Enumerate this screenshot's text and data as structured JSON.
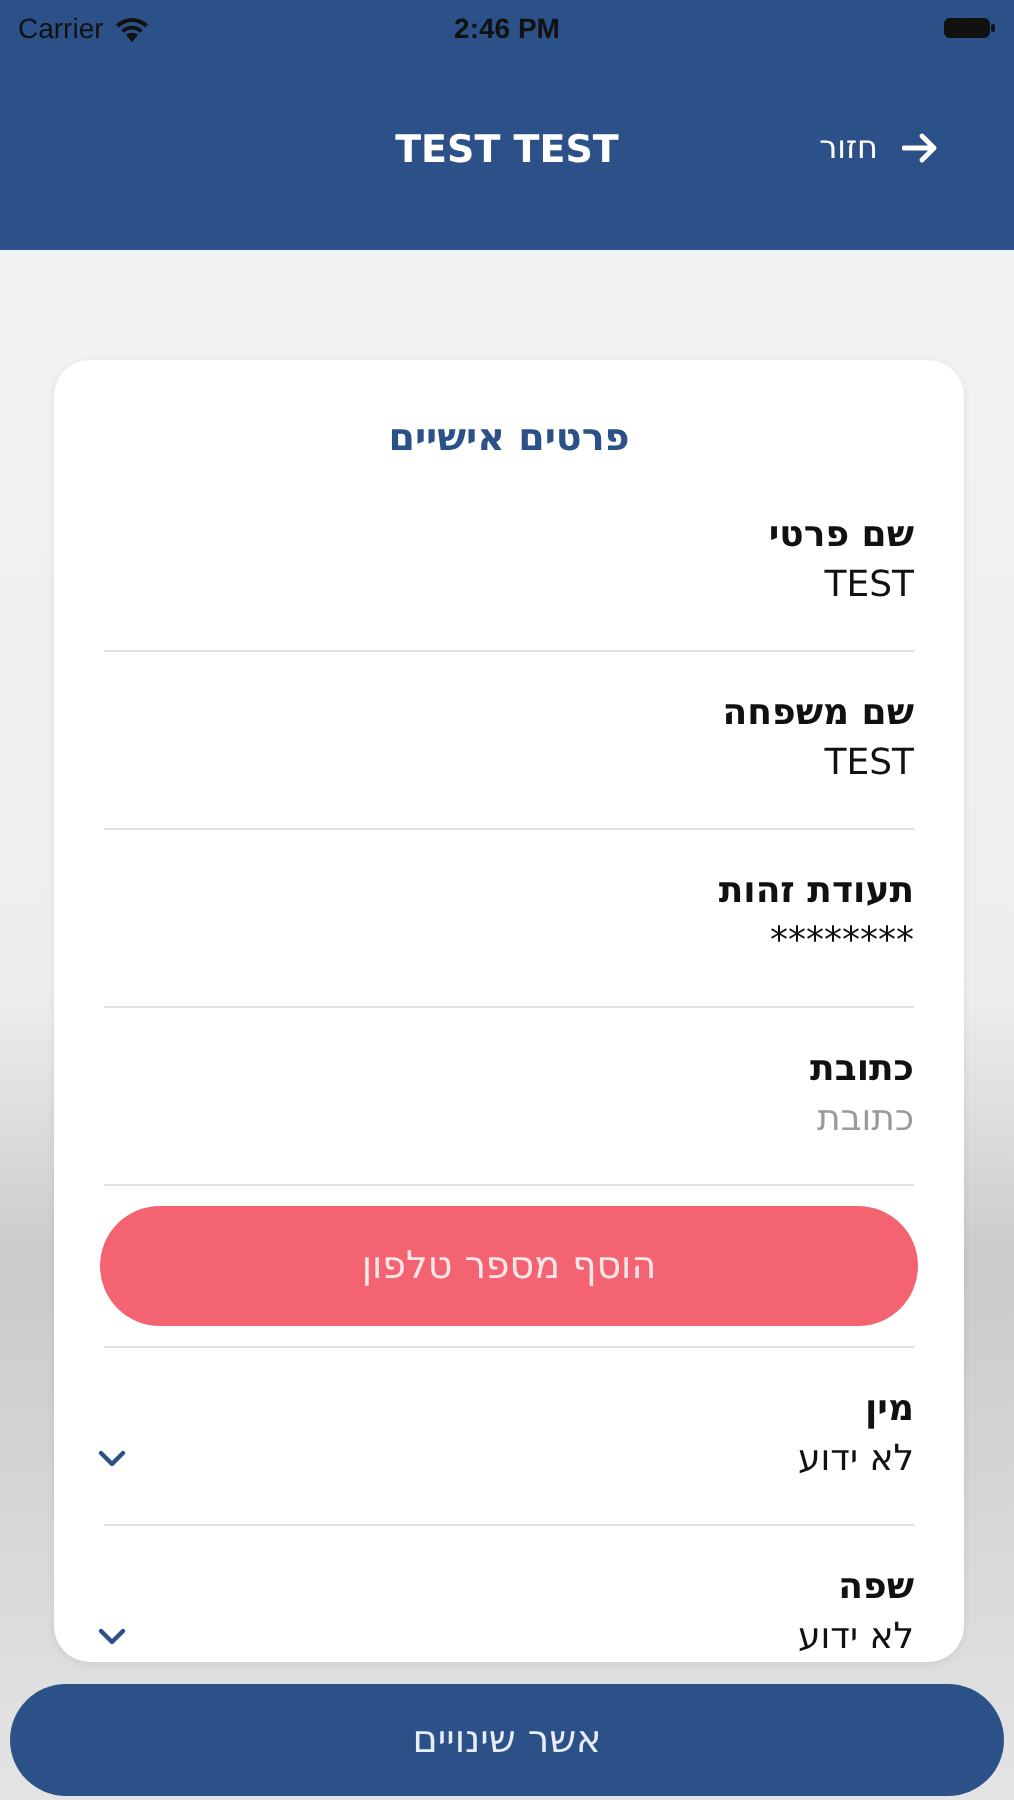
{
  "status_bar": {
    "carrier": "Carrier",
    "time": "2:46 PM"
  },
  "header": {
    "title": "TEST TEST",
    "back_label": "חזור"
  },
  "card": {
    "title": "פרטים אישיים",
    "fields": [
      {
        "kind": "text",
        "label": "שם פרטי",
        "value": "TEST"
      },
      {
        "kind": "text",
        "label": "שם משפחה",
        "value": "TEST"
      },
      {
        "kind": "text",
        "label": "תעודת זהות",
        "value": "********"
      },
      {
        "kind": "text",
        "label": "כתובת",
        "placeholder": "כתובת"
      },
      {
        "kind": "button",
        "label": "הוסף מספר טלפון"
      },
      {
        "kind": "select",
        "label": "מין",
        "value": "לא ידוע"
      },
      {
        "kind": "select",
        "label": "שפה",
        "value": "לא ידוע"
      }
    ]
  },
  "confirm_button": "אשר שינויים"
}
